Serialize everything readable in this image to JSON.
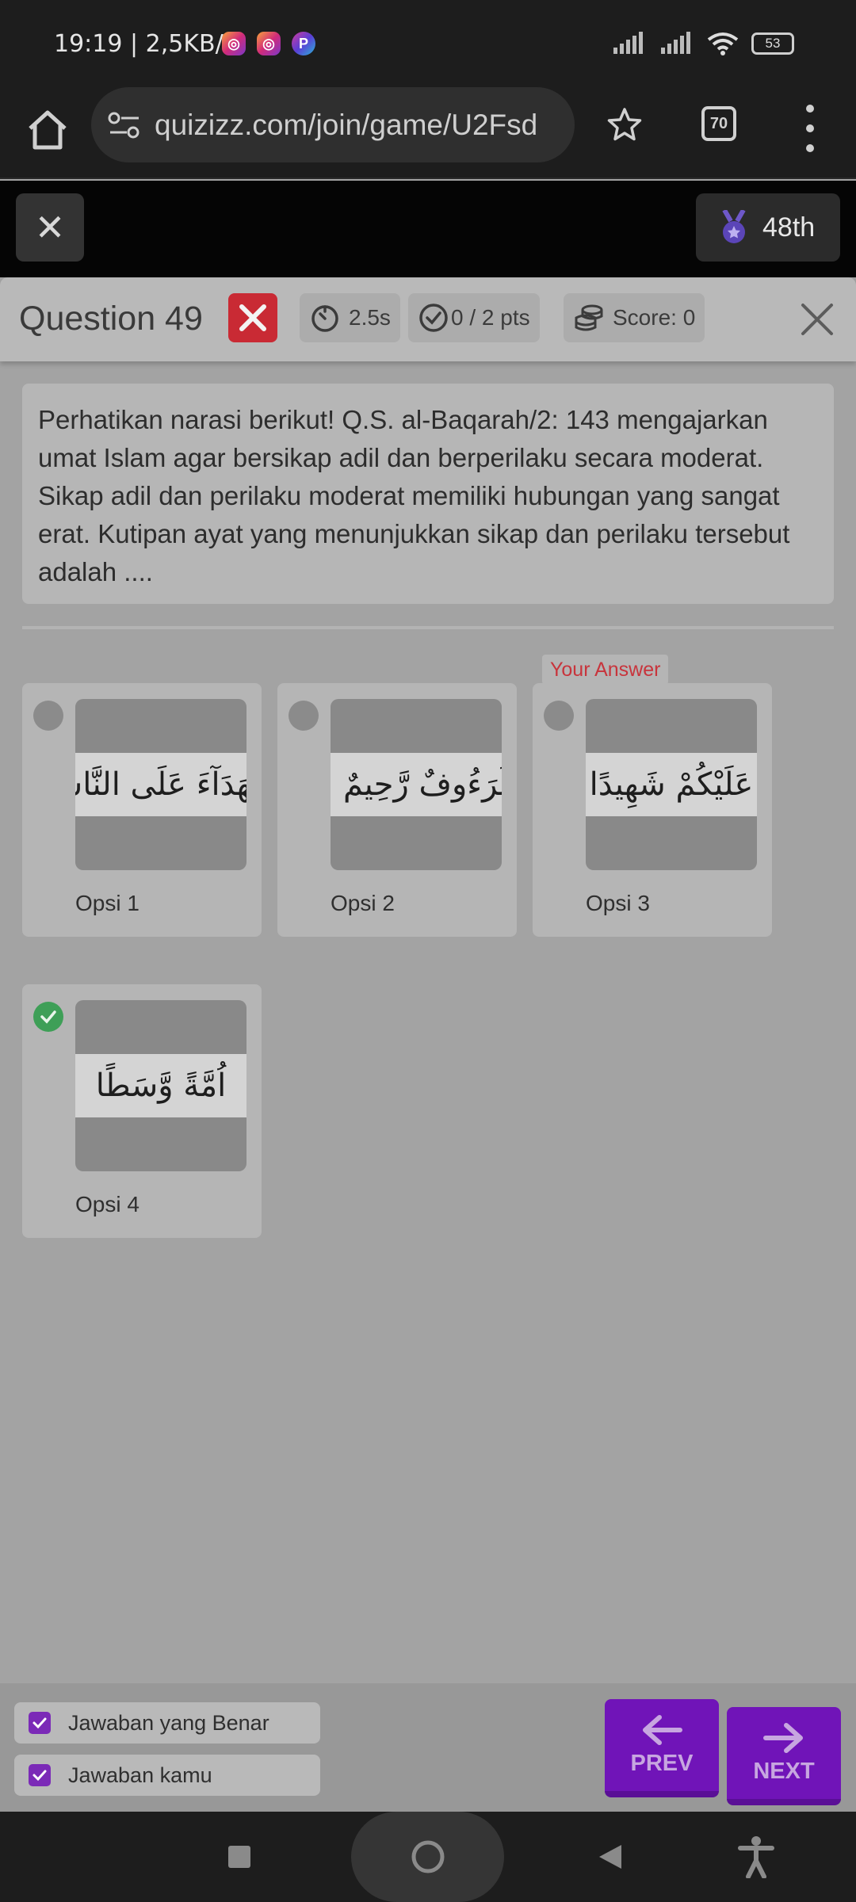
{
  "status_bar": {
    "time": "19:19 | 2,5KB/d",
    "battery": "53",
    "app_icons": [
      "instagram-icon",
      "instagram-icon",
      "picsart-icon"
    ]
  },
  "browser": {
    "url": "quizizz.com/join/game/U2Fsd",
    "tab_count": "70"
  },
  "game_bar": {
    "rank": "48th"
  },
  "question": {
    "title": "Question 49",
    "time": "2.5s",
    "points": "0 / 2 pts",
    "score": "Score: 0",
    "text": "Perhatikan narasi berikut! Q.S. al-Baqarah/2: 143 mengajarkan umat Islam agar bersikap adil dan berperilaku secara moderat. Sikap adil dan perilaku moderat memiliki hubungan yang sangat erat. Kutipan ayat yang menunjukkan sikap dan perilaku tersebut adalah ...."
  },
  "your_answer_label": "Your Answer",
  "options": [
    {
      "label": "Opsi 1",
      "arabic": "شُهَدَآءَ عَلَى النَّاسِ"
    },
    {
      "label": "Opsi 2",
      "arabic": "لَرَءُوفٌ رَّحِيمٌ ."
    },
    {
      "label": "Opsi 3",
      "arabic": "عَلَيْكُمْ شَهِيدًا"
    },
    {
      "label": "Opsi 4",
      "arabic": "اُمَّةً وَّسَطًا"
    }
  ],
  "footer": {
    "show_correct_label": "Jawaban yang Benar",
    "show_yours_label": "Jawaban kamu",
    "prev_label": "PREV",
    "next_label": "NEXT"
  },
  "colors": {
    "accent": "#7014b8",
    "wrong": "#c92a34",
    "correct": "#3e9f57"
  }
}
